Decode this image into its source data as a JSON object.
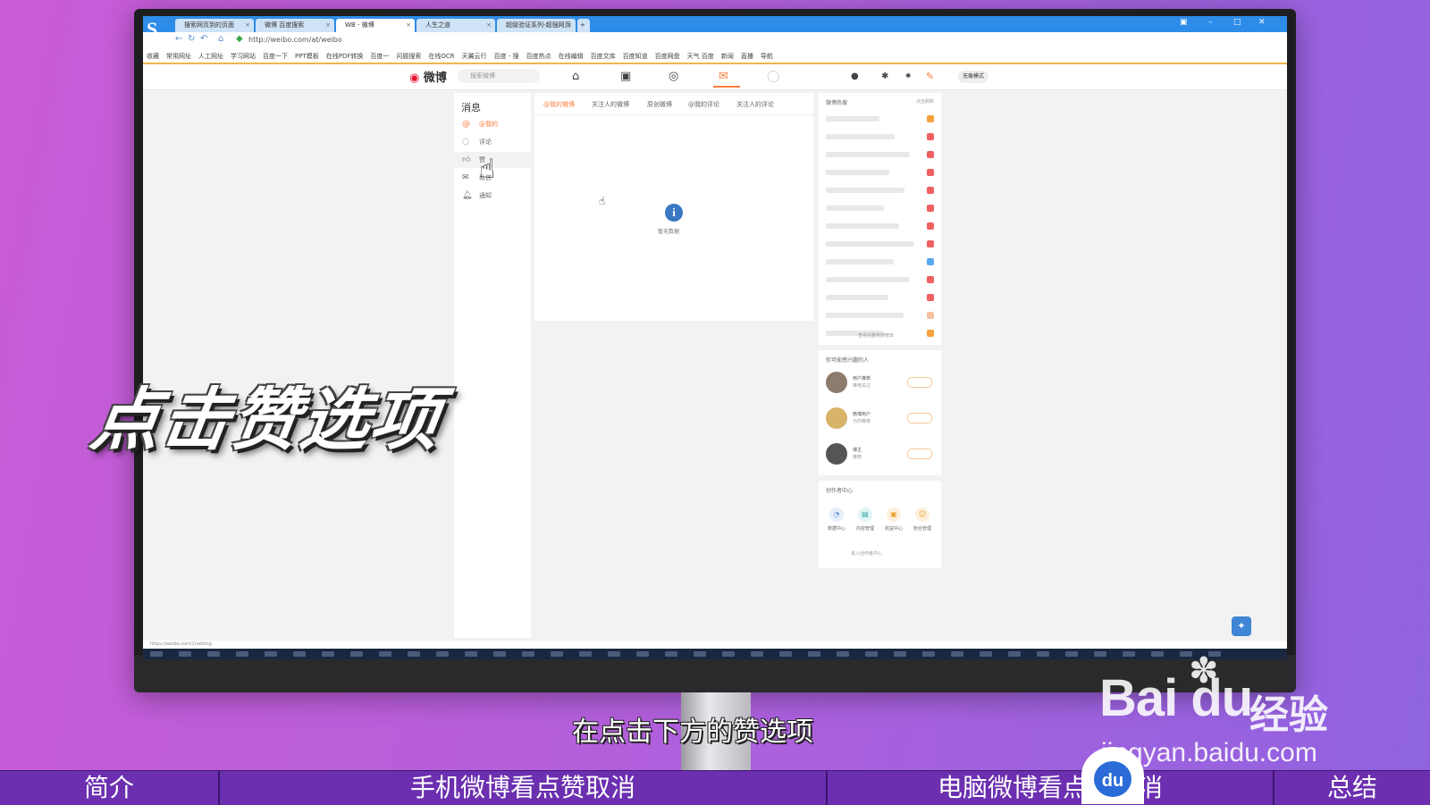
{
  "browser": {
    "logo": "S",
    "tabs": [
      {
        "label": "搜索网页到的页面"
      },
      {
        "label": "微博 百度搜索"
      },
      {
        "label": "WB - 微博"
      },
      {
        "label": "人生之道"
      },
      {
        "label": "超级验证系列-超强网页"
      }
    ],
    "address": "http://weibo.com/at/weibo",
    "bookmarks": [
      "收藏",
      "常用网址",
      "人工网址",
      "学习网站",
      "百度一下",
      "PPT模板",
      "在线PDF转换",
      "百度一",
      "问题搜索",
      "在线OCR",
      "天翼云行",
      "百度 - 搜",
      "百度热点",
      "在线编辑",
      "百度文库",
      "百度知道",
      "百度网盘",
      "天气 百度",
      "新闻",
      "直播",
      "导航"
    ],
    "status_url": "https://weibo.com/1/setting"
  },
  "weibo_header": {
    "logo_text": "微博",
    "search_placeholder": "搜索微博",
    "login_pill": "无痕模式"
  },
  "left_nav": {
    "title": "消息",
    "items": [
      {
        "label": "@我的",
        "icon": "at-icon"
      },
      {
        "label": "评论",
        "icon": "comment-icon"
      },
      {
        "label": "赞",
        "icon": "like-icon"
      },
      {
        "label": "私信",
        "icon": "mail-icon"
      },
      {
        "label": "通知",
        "icon": "bell-icon"
      }
    ]
  },
  "main": {
    "subtabs": [
      "@我的微博",
      "关注人的微博",
      "原创微博",
      "@我的评论",
      "关注人的评论"
    ],
    "empty_text": "暂无数据"
  },
  "right_col": {
    "hot_title": "微博热搜",
    "hot_more": "点击刷新",
    "hot_footer": "查看完整热搜榜单",
    "follow_title": "你可能感兴趣的人",
    "people": [
      {
        "name": "用户推荐",
        "desc": "推荐关注"
      },
      {
        "name": "微博用户",
        "desc": "为你推荐"
      },
      {
        "name": "博主",
        "desc": "推荐"
      }
    ],
    "creator_title": "创作者中心",
    "creator_items": [
      "数据中心",
      "内容管理",
      "收益中心",
      "粉丝管理"
    ],
    "creator_enter": "进入创作者中心"
  },
  "overlay": {
    "big_caption": "点击赞选项",
    "subtitle": "在点击下方的赞选项",
    "watermark_logo": "Bai du",
    "watermark_jy": "经验",
    "watermark_url": "jingyan.baidu.com",
    "badge": "du"
  },
  "bottom_nav": [
    {
      "label": "简介"
    },
    {
      "label": "手机微博看点赞取消"
    },
    {
      "label": "电脑微博看点赞取消"
    },
    {
      "label": "总结"
    }
  ],
  "colors": {
    "weibo_orange": "#fa7d3c",
    "browser_blue": "#2d8ce8",
    "nav_strip": "#6b2fb0"
  }
}
